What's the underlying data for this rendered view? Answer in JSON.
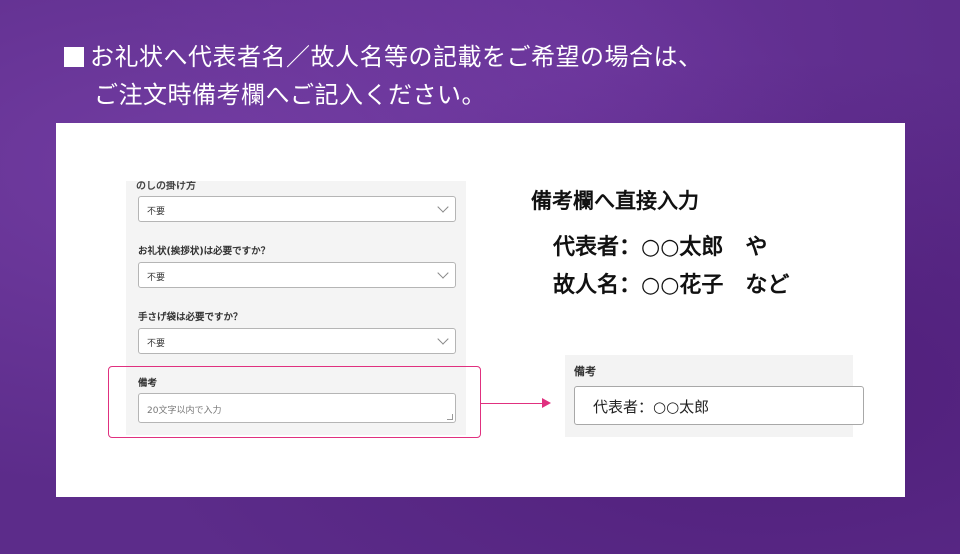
{
  "headline": {
    "line1": "お礼状へ代表者名／故人名等の記載をご希望の場合は、",
    "line2": "ご注文時備考欄へご記入ください。"
  },
  "form": {
    "cut_label": "のしの掛け方",
    "fields": [
      {
        "label": "",
        "value": "不要"
      },
      {
        "label": "お礼状(挨拶状)は必要ですか？",
        "value": "不要"
      },
      {
        "label": "手さげ袋は必要ですか？",
        "value": "不要"
      }
    ],
    "remarks_label": "備考",
    "remarks_placeholder": "20文字以内で入力"
  },
  "instructions": {
    "title": "備考欄へ直接入力",
    "line1": "代表者：○○太郎　や",
    "line2": "故人名：○○花子　など"
  },
  "zoom": {
    "label": "備考",
    "value": "代表者：○○太郎"
  },
  "colors": {
    "background": "#5c2c8a",
    "highlight": "#e0307f"
  }
}
